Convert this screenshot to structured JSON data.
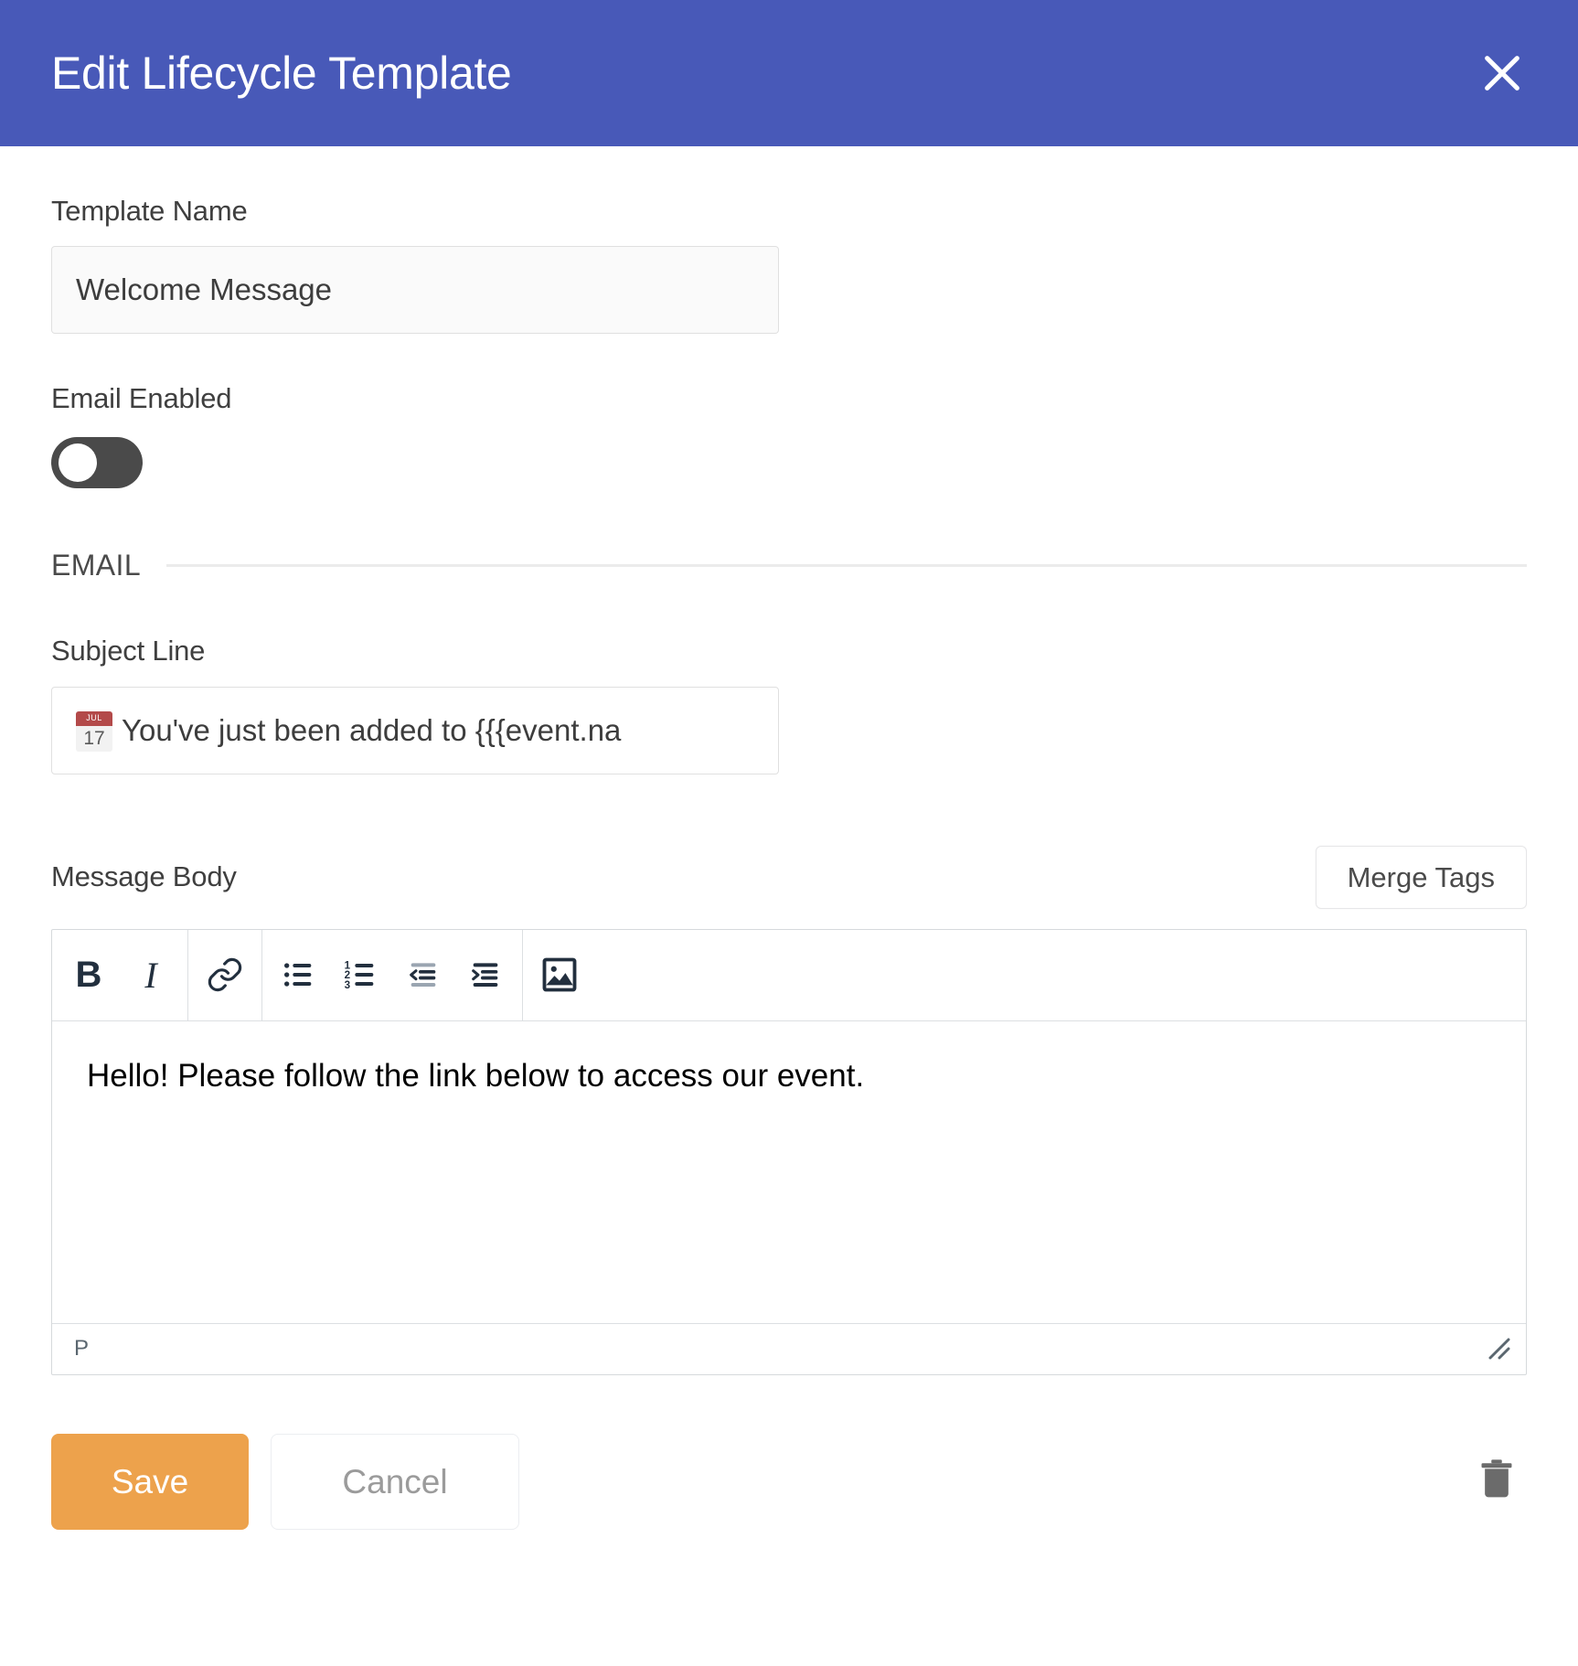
{
  "header": {
    "title": "Edit Lifecycle Template",
    "close_icon": "close-x-icon",
    "background_color": "#4859b8"
  },
  "form": {
    "template_name": {
      "label": "Template Name",
      "value": "Welcome Message",
      "placeholder": "Template Name"
    },
    "email_enabled": {
      "label": "Email Enabled",
      "state": "off"
    },
    "email_section": {
      "title": "EMAIL"
    },
    "subject_line": {
      "label": "Subject Line",
      "emoji_icon": "calendar-emoji",
      "emoji_month": "JUL",
      "emoji_day": "17",
      "value": "You've just been added to {{{event.name}}}",
      "visible_value": "You've just been added to {{{event.na",
      "placeholder": "Subject Line"
    },
    "message_body": {
      "label": "Message Body",
      "merge_tags_label": "Merge Tags",
      "content": "Hello! Please follow the link below to access our event.",
      "status_path": "P",
      "toolbar": [
        {
          "name": "bold",
          "label": "B",
          "icon": "bold-icon"
        },
        {
          "name": "italic",
          "label": "I",
          "icon": "italic-icon"
        },
        {
          "name": "link",
          "label": "",
          "icon": "link-icon"
        },
        {
          "name": "bullet-list",
          "label": "",
          "icon": "bullet-list-icon"
        },
        {
          "name": "numbered-list",
          "label": "",
          "icon": "numbered-list-icon"
        },
        {
          "name": "outdent",
          "label": "",
          "icon": "outdent-icon"
        },
        {
          "name": "indent",
          "label": "",
          "icon": "indent-icon"
        },
        {
          "name": "insert-image",
          "label": "",
          "icon": "image-icon"
        }
      ]
    }
  },
  "footer": {
    "save_label": "Save",
    "cancel_label": "Cancel",
    "delete_icon": "trash-icon",
    "save_color": "#eda24c"
  }
}
